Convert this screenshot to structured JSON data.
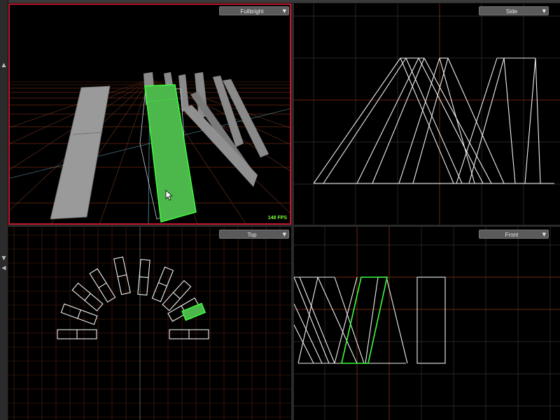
{
  "viewports": {
    "perspective": {
      "mode_label": "Fullbright",
      "fps_label": "148 FPS"
    },
    "side": {
      "view_label": "Side"
    },
    "top": {
      "view_label": "Top"
    },
    "front": {
      "view_label": "Front"
    }
  },
  "icons": {
    "dropdown_caret": "chevron-down-icon",
    "edge_arrow_up": "arrow-up-icon",
    "edge_arrow_down": "arrow-down-icon",
    "edge_arrow_left": "arrow-left-icon",
    "cursor": "mouse-pointer-icon"
  },
  "colors": {
    "selection": "#3cd23c",
    "active_frame": "#c0142a",
    "grid_major": "#8a2a10",
    "grid_minor": "#333333",
    "wireframe": "#f0f0f0",
    "fps_text": "#7cff3c"
  }
}
